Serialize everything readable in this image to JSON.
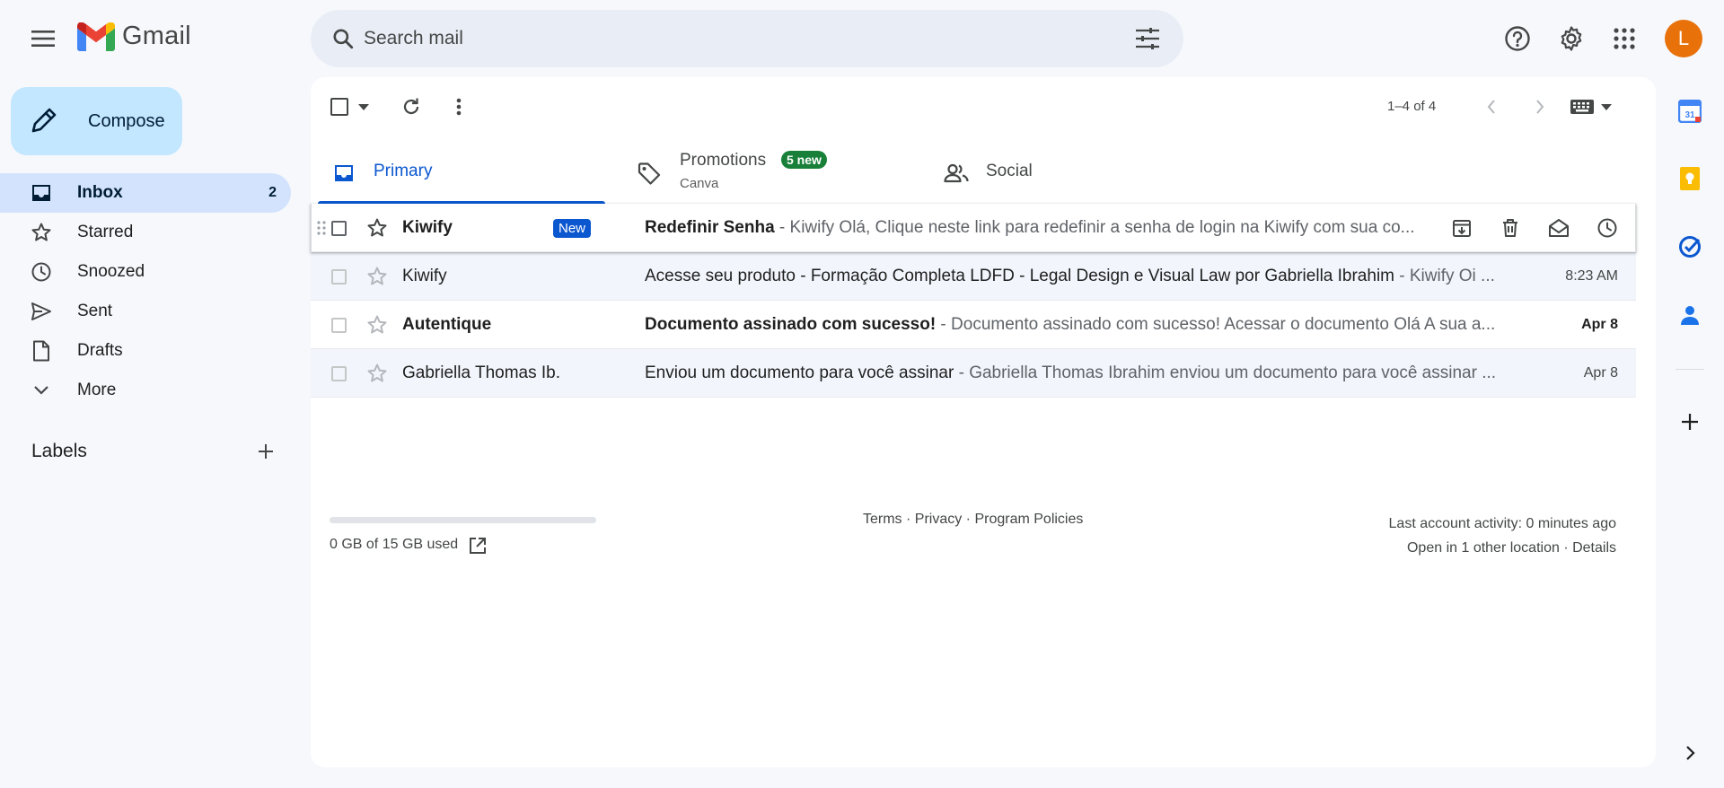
{
  "app": {
    "name": "Gmail",
    "menu_icon": "hamburger-menu-icon",
    "logo_icon": "gmail-m-logo"
  },
  "search": {
    "placeholder": "Search mail",
    "icon": "search-icon",
    "filter_icon": "tune-icon"
  },
  "header_icons": [
    "help-icon",
    "settings-gear-icon",
    "apps-grid-icon"
  ],
  "account": {
    "initial": "L",
    "color": "#e8710a"
  },
  "compose": {
    "label": "Compose",
    "icon": "pencil-icon"
  },
  "nav": {
    "items": [
      {
        "label": "Inbox",
        "count": "2",
        "icon": "inbox-icon",
        "active": true
      },
      {
        "label": "Starred",
        "count": "",
        "icon": "star-icon"
      },
      {
        "label": "Snoozed",
        "count": "",
        "icon": "clock-icon"
      },
      {
        "label": "Sent",
        "count": "",
        "icon": "send-icon"
      },
      {
        "label": "Drafts",
        "count": "",
        "icon": "draft-icon"
      },
      {
        "label": "More",
        "count": "",
        "icon": "chevron-down-icon"
      }
    ]
  },
  "labels": {
    "heading": "Labels",
    "add_icon": "plus-icon"
  },
  "toolbar": {
    "pagination": "1–4 of 4",
    "icons": [
      "select-all-checkbox",
      "select-dropdown-icon",
      "refresh-icon",
      "more-vert-icon",
      "chevron-left-icon",
      "chevron-right-icon",
      "keyboard-icon",
      "dropdown-caret-icon"
    ]
  },
  "tabs": [
    {
      "label": "Primary",
      "icon": "inbox-tab-icon",
      "active": true
    },
    {
      "label": "Promotions",
      "icon": "tag-icon",
      "badge": "5 new",
      "sub": "Canva"
    },
    {
      "label": "Social",
      "icon": "people-icon"
    }
  ],
  "emails": [
    {
      "sender": "Kiwify",
      "badge": "New",
      "subject": "Redefinir Senha",
      "preview": " - Kiwify Olá, Clique neste link para redefinir a senha de login na Kiwify com sua co...",
      "date": "",
      "unread": true,
      "hover": true,
      "actions": [
        "archive-icon",
        "delete-icon",
        "mark-read-icon",
        "snooze-icon"
      ]
    },
    {
      "sender": "Kiwify",
      "badge": "",
      "subject": "Acesse seu produto - Formação Completa LDFD - Legal Design e Visual Law por Gabriella Ibrahim",
      "preview": " - Kiwify Oi ...",
      "date": "8:23 AM",
      "unread": false
    },
    {
      "sender": "Autentique",
      "badge": "",
      "subject": "Documento assinado com sucesso!",
      "preview": " - Documento assinado com sucesso! Acessar o documento Olá A sua a...",
      "date": "Apr 8",
      "unread": true
    },
    {
      "sender": "Gabriella Thomas Ib.",
      "badge": "",
      "subject": "Enviou um documento para você assinar",
      "preview": " - Gabriella Thomas Ibrahim enviou um documento para você assinar ...",
      "date": "Apr 8",
      "unread": false
    }
  ],
  "footer": {
    "storage": "0 GB of 15 GB used",
    "storage_fraction": 0,
    "terms": "Terms",
    "privacy": "Privacy",
    "policies": "Program Policies",
    "sep": " · ",
    "activity": "Last account activity: 0 minutes ago",
    "location": "Open in 1 other location",
    "details": "Details"
  },
  "side_panel": {
    "icons": [
      "calendar-icon",
      "keep-icon",
      "tasks-icon",
      "contacts-icon",
      "add-addon-icon",
      "expand-panel-icon"
    ],
    "calendar_day": "31"
  }
}
